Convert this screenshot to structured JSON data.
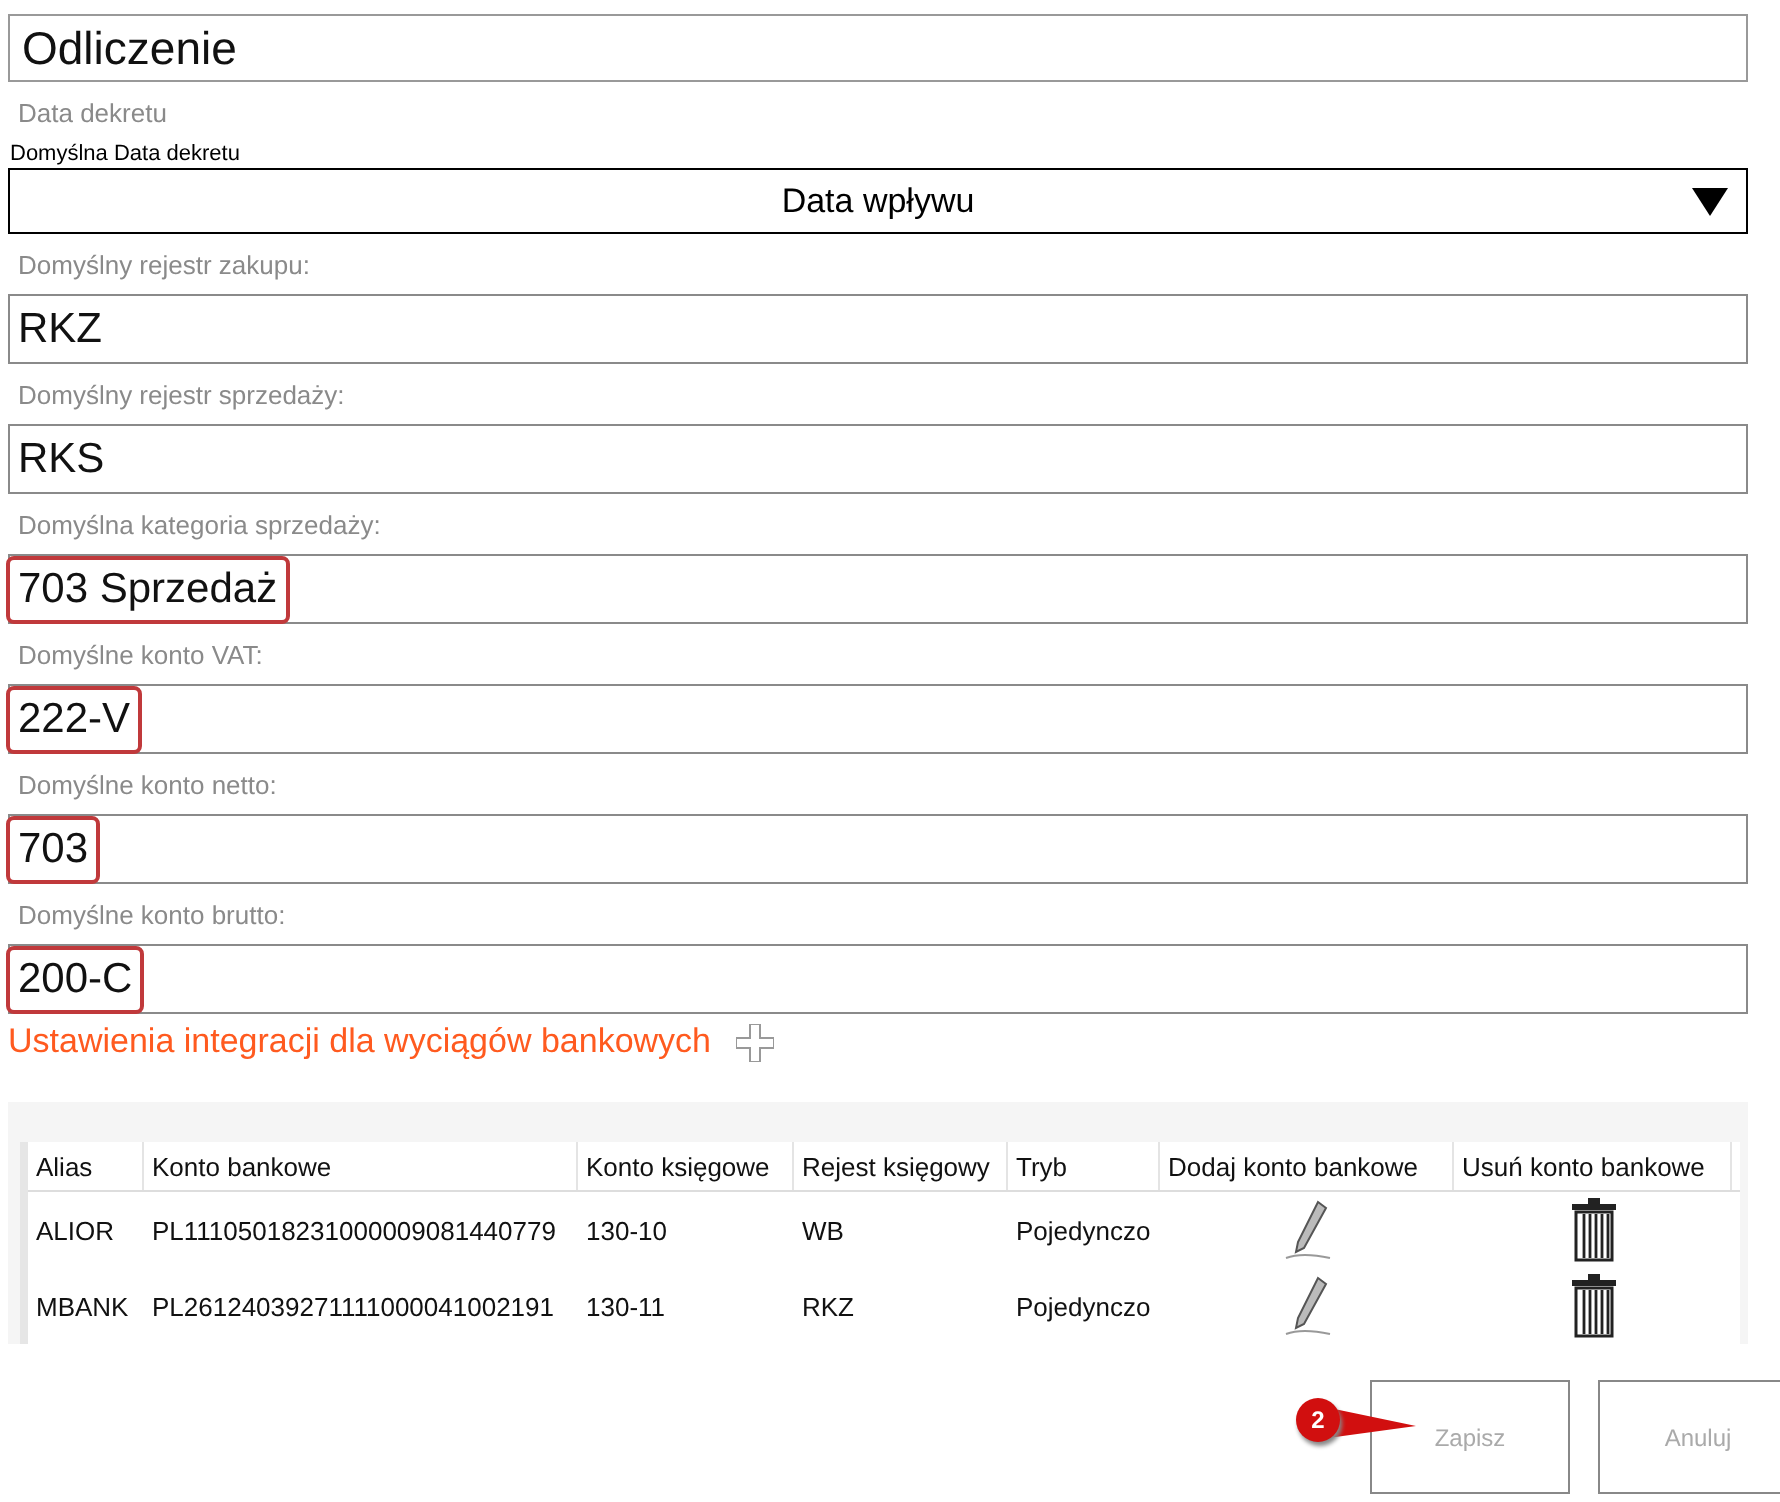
{
  "title": "Odliczenie",
  "section_label": "Data dekretu",
  "date_default": {
    "label": "Domyślna Data dekretu",
    "value": "Data wpływu"
  },
  "fields": [
    {
      "label": "Domyślny rejestr zakupu:",
      "value": "RKZ",
      "highlighted": false
    },
    {
      "label": "Domyślny rejestr sprzedaży:",
      "value": "RKS",
      "highlighted": false
    },
    {
      "label": "Domyślna kategoria sprzedaży:",
      "value": "703 Sprzedaż",
      "highlighted": true
    },
    {
      "label": "Domyślne konto VAT:",
      "value": "222-V",
      "highlighted": true
    },
    {
      "label": "Domyślne konto netto:",
      "value": "703",
      "highlighted": true
    },
    {
      "label": "Domyślne konto brutto:",
      "value": "200-C",
      "highlighted": true
    }
  ],
  "bank_section": {
    "heading": "Ustawienia integracji dla wyciągów bankowych"
  },
  "table": {
    "columns": [
      "Alias",
      "Konto bankowe",
      "Konto księgowe",
      "Rejest księgowy",
      "Tryb",
      "Dodaj konto bankowe",
      "Usuń konto bankowe"
    ],
    "rows": [
      {
        "alias": "ALIOR",
        "account": "PL11105018231000009081440779",
        "ledger": "130-10",
        "register": "WB",
        "mode": "Pojedynczo"
      },
      {
        "alias": "MBANK",
        "account": "PL26124039271111000041002191",
        "ledger": "130-11",
        "register": "RKZ",
        "mode": "Pojedynczo"
      }
    ]
  },
  "buttons": [
    {
      "label": "Zapisz"
    },
    {
      "label": "Anuluj"
    }
  ],
  "callout": {
    "number": "2"
  }
}
